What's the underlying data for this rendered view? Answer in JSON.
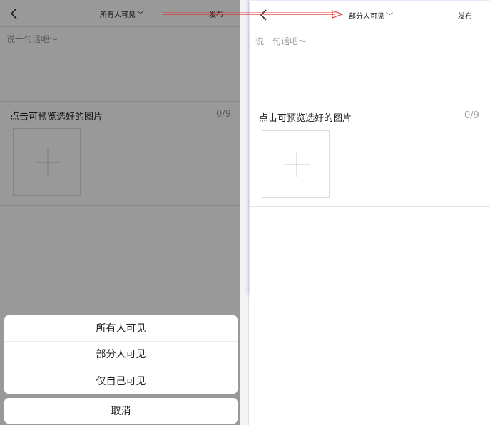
{
  "left": {
    "nav": {
      "title": "所有人可见",
      "chevron": "﹀",
      "publish": "发布",
      "back_icon": "chevron-left-icon"
    },
    "compose_placeholder": "说一句话吧～",
    "image_section": {
      "label": "点击可预览选好的图片",
      "count": "0/9"
    },
    "action_sheet": {
      "options": [
        "所有人可见",
        "部分人可见",
        "仅自己可见"
      ],
      "cancel": "取消"
    }
  },
  "right": {
    "nav": {
      "title": "部分人可见",
      "chevron": "﹀",
      "publish": "发布",
      "back_icon": "chevron-left-icon"
    },
    "compose_placeholder": "说一句话吧～",
    "image_section": {
      "label": "点击可预览选好的图片",
      "count": "0/9"
    }
  },
  "colors": {
    "annotation_arrow": "#e03030",
    "overlay": "rgba(0,0,0,0.40)",
    "glow": "#8aa6ee"
  }
}
